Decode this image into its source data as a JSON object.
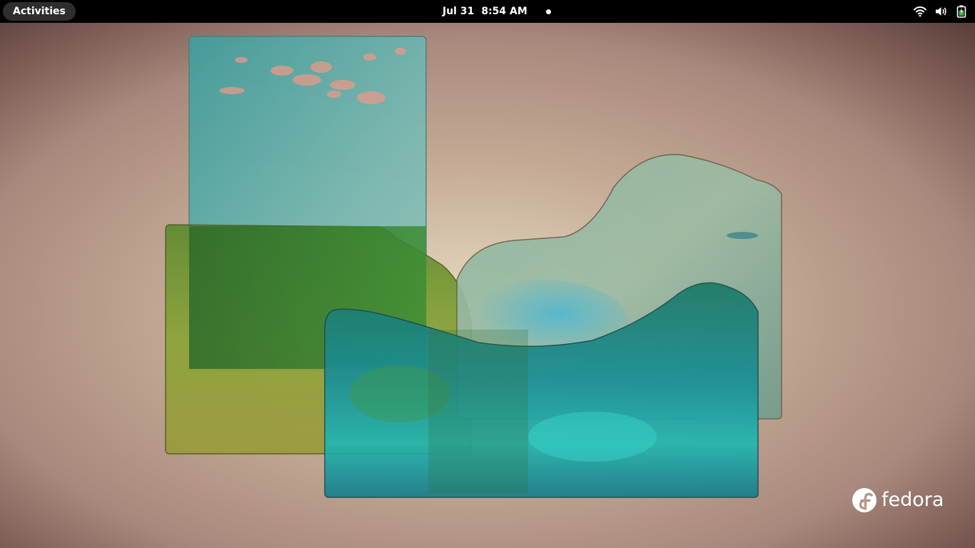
{
  "topbar": {
    "activities_label": "Activities",
    "date": "Jul 31",
    "time": "8:54 AM"
  },
  "status_icons": [
    "wifi-icon",
    "volume-icon",
    "battery-icon"
  ],
  "desktop": {
    "logo_text": "fedora"
  },
  "colors": {
    "topbar": "#000000",
    "activities_bg": "#2e2e2e",
    "accent_battery": "#3cb043"
  }
}
